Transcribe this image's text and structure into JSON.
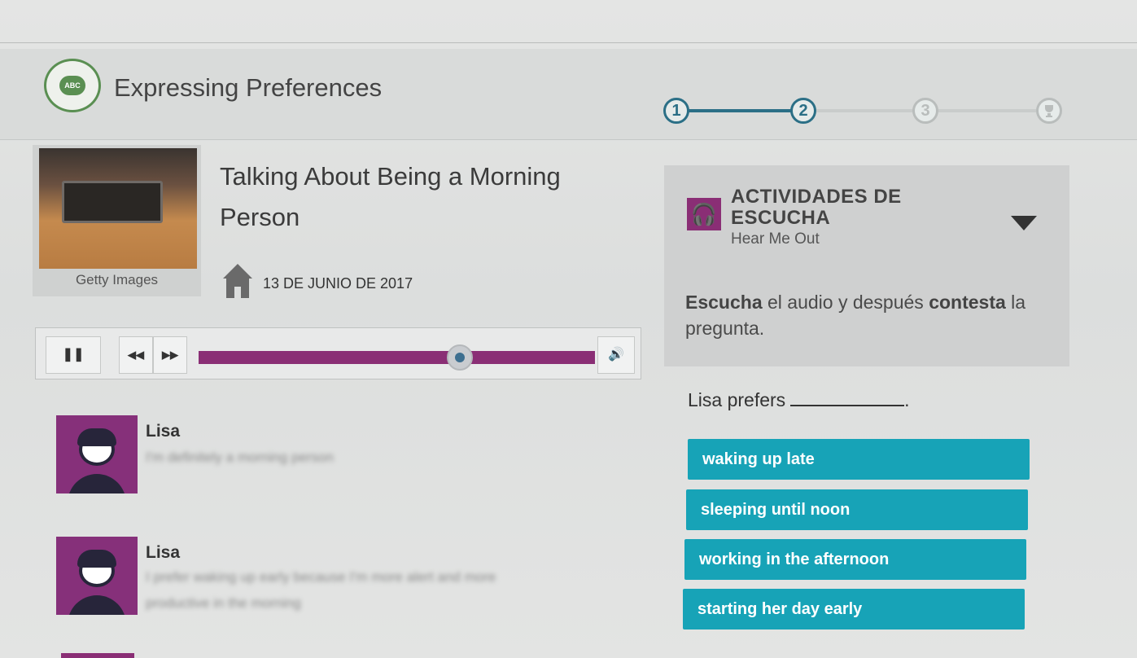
{
  "header": {
    "logo_text": "ABC",
    "title": "Expressing Preferences",
    "steps": [
      "1",
      "2",
      "3",
      ""
    ]
  },
  "lesson": {
    "image_credit": "Getty Images",
    "title": "Talking About Being a Morning Person",
    "date": "13 DE JUNIO DE 2017"
  },
  "player": {
    "progress": 0.66
  },
  "transcript": [
    {
      "speaker": "Lisa",
      "lines": [
        "I'm definitely a morning person"
      ]
    },
    {
      "speaker": "Lisa",
      "lines": [
        "I prefer waking up early because I'm more alert and more",
        "productive in the morning"
      ]
    }
  ],
  "activity": {
    "title": "ACTIVIDADES DE ESCUCHA",
    "subtitle": "Hear Me Out",
    "instruction_bold_1": "Escucha",
    "instruction_text_1": " el audio y después ",
    "instruction_bold_2": "contesta",
    "instruction_text_2": " la pregunta."
  },
  "question": {
    "prefix": "Lisa prefers",
    "suffix": "."
  },
  "options": [
    "waking up late",
    "sleeping until noon",
    "working in the afternoon",
    "starting her day early"
  ],
  "colors": {
    "accent_purple": "#8a2e75",
    "option_teal": "#17a3b7",
    "step_active": "#2b6f86",
    "logo_green": "#5a8f52"
  },
  "icons": {
    "logo": "chat-bubble-icon",
    "home": "home-icon",
    "pause": "pause-icon",
    "rewind": "rewind-icon",
    "forward": "fast-forward-icon",
    "volume": "volume-icon",
    "headphones": "headphones-icon",
    "toggle": "caret-down-icon"
  }
}
